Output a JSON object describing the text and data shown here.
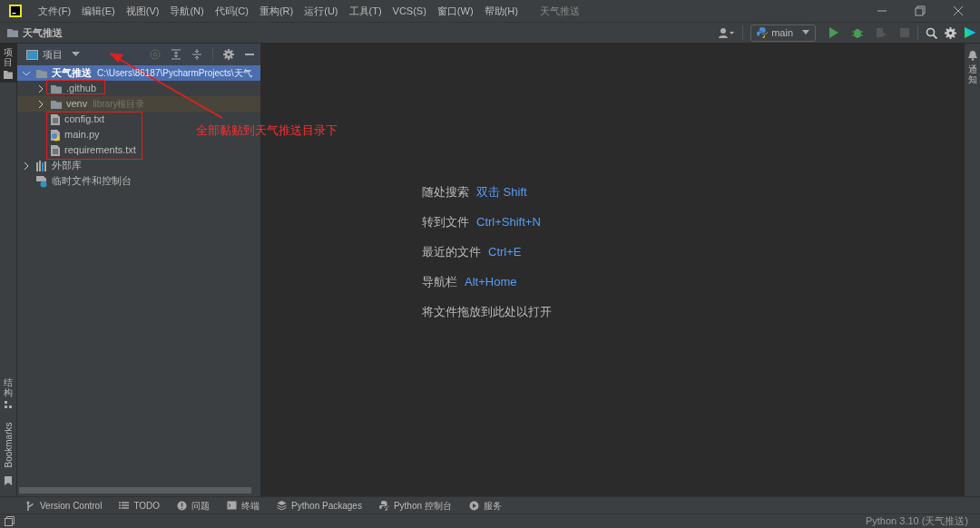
{
  "menu": {
    "items": [
      "文件(F)",
      "编辑(E)",
      "视图(V)",
      "导航(N)",
      "代码(C)",
      "重构(R)",
      "运行(U)",
      "工具(T)",
      "VCS(S)",
      "窗口(W)",
      "帮助(H)"
    ],
    "title": "天气推送"
  },
  "nav": {
    "breadcrumb": "天气推送",
    "run_config": "main"
  },
  "left_stripe": [
    {
      "label": "项目",
      "selected": true,
      "kind": "cjk"
    },
    {
      "label": "结构",
      "selected": false,
      "kind": "cjk"
    },
    {
      "label": "Bookmarks",
      "selected": false,
      "kind": "latin"
    }
  ],
  "right_stripe": [
    {
      "label": "通知"
    }
  ],
  "project": {
    "title": "项目",
    "tree": [
      {
        "name": "天气推送",
        "hint": "C:\\Users\\86187\\PycharmProjects\\天气",
        "kind": "folder",
        "expanded": true,
        "selected": true,
        "children": [
          {
            "name": ".github",
            "kind": "folder",
            "expanded": false,
            "selected": false,
            "excluded": false
          },
          {
            "name": "venv",
            "hint": "library根目录",
            "kind": "folder",
            "expanded": false,
            "selected": false,
            "excluded": true
          },
          {
            "name": "config.txt",
            "kind": "text",
            "selected": false
          },
          {
            "name": "main.py",
            "kind": "python",
            "selected": false
          },
          {
            "name": "requirements.txt",
            "kind": "text",
            "selected": false
          }
        ]
      },
      {
        "name": "外部库",
        "kind": "library",
        "expanded": false,
        "selected": false
      },
      {
        "name": "临时文件和控制台",
        "kind": "scratch",
        "selected": false
      }
    ]
  },
  "editor_hints": [
    {
      "action": "随处搜索",
      "shortcut": "双击 Shift"
    },
    {
      "action": "转到文件",
      "shortcut": "Ctrl+Shift+N"
    },
    {
      "action": "最近的文件",
      "shortcut": "Ctrl+E"
    },
    {
      "action": "导航栏",
      "shortcut": "Alt+Home"
    },
    {
      "action": "将文件拖放到此处以打开"
    }
  ],
  "bottom_tabs": [
    {
      "label": "Version Control",
      "kind": "branch"
    },
    {
      "label": "TODO",
      "kind": "list"
    },
    {
      "label": "问题",
      "kind": "info"
    },
    {
      "label": "终端",
      "kind": "terminal"
    },
    {
      "label": "Python Packages",
      "kind": "layers"
    },
    {
      "label": "Python 控制台",
      "kind": "python"
    },
    {
      "label": "服务",
      "kind": "play"
    }
  ],
  "status_bar": {
    "interpreter": "Python 3.10 (天气推送)"
  },
  "annotation": {
    "callout": "全部黏贴到天气推送目录下"
  }
}
